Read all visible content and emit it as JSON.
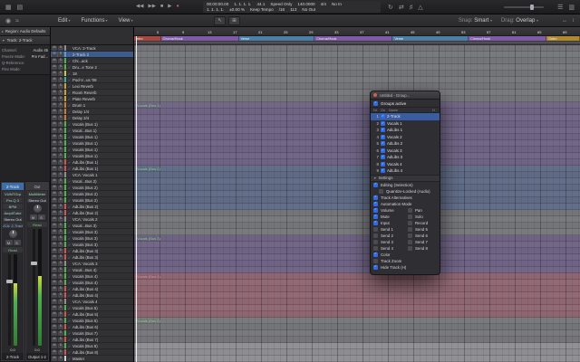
{
  "ui": {
    "check": "✓",
    "chevron": "▾",
    "disclosure_open": "▼",
    "disclosure_closed": "▸"
  },
  "control_bar": {
    "left_icons": [
      {
        "name": "toolbar-toggle-icon",
        "glyph": "▦"
      },
      {
        "name": "library-icon",
        "glyph": "▤"
      }
    ],
    "transport_icons": [
      {
        "name": "rewind-icon",
        "glyph": "◀◀"
      },
      {
        "name": "forward-icon",
        "glyph": "▶▶"
      },
      {
        "name": "stop-icon",
        "glyph": "■"
      },
      {
        "name": "play-icon",
        "glyph": "▶"
      },
      {
        "name": "record-icon",
        "glyph": "●",
        "color": "#d05555"
      }
    ],
    "lcd_row1": [
      "00:00:00.00",
      "1. 1. 1. 1.",
      "44.1",
      "Speed Only",
      "140.0000",
      "4/4",
      "No In"
    ],
    "lcd_row2": [
      "1. 1. 1. 1.",
      "±0.00 %",
      "Keep Tempo",
      "/16",
      "113",
      "No Out"
    ],
    "right_icons": [
      {
        "name": "cycle-icon",
        "glyph": "↻"
      },
      {
        "name": "replace-icon",
        "glyph": "⇄"
      },
      {
        "name": "tuner-icon",
        "glyph": "♯"
      },
      {
        "name": "metronome-icon",
        "glyph": "△"
      }
    ],
    "far_right_icons": [
      {
        "name": "list-editors-icon",
        "glyph": "☰"
      },
      {
        "name": "browsers-icon",
        "glyph": "▥"
      }
    ]
  },
  "toolbar": {
    "left_icons": [
      {
        "name": "automation-icon",
        "glyph": "◉"
      },
      {
        "name": "flex-icon",
        "glyph": "≈"
      }
    ],
    "menus": [
      "Edit",
      "Functions",
      "View"
    ],
    "tool_icons": [
      {
        "name": "pointer-tool-icon",
        "glyph": "↖"
      },
      {
        "name": "marquee-tool-icon",
        "glyph": "⊞"
      }
    ],
    "snap": {
      "label": "Snap:",
      "value": "Smart"
    },
    "drag": {
      "label": "Drag:",
      "value": "Overlap"
    },
    "right_icons": [
      {
        "name": "zoom-horizontal-icon",
        "glyph": "↔"
      },
      {
        "name": "zoom-vertical-icon",
        "glyph": "↕"
      }
    ]
  },
  "inspector": {
    "region_title": "Region: Audio Defaults",
    "track_title": "Track: 2-Track",
    "fields": [
      {
        "label": "Channel:",
        "value": "Audio 45"
      },
      {
        "label": "Freeze Mode:",
        "value": "Pre Fad..."
      },
      {
        "label": "Q-Reference:",
        "value": ""
      },
      {
        "label": "Flex Mode:",
        "value": ""
      }
    ]
  },
  "strips": {
    "left": {
      "header": "2-Track",
      "inserts": [
        "VUMTGrp",
        "Pro-Q 3",
        "BPM",
        "AmpliTube"
      ],
      "output": "Stereo Out",
      "group": "VCA: 2-Track",
      "automation": "Read",
      "mute_label": "M",
      "solo_label": "S",
      "gain": "0.0",
      "name": "2-Track",
      "meter_level": 0.68
    },
    "right": {
      "header": "Out",
      "inserts": [
        "MultiMeter"
      ],
      "output": "Stereo Out",
      "automation": "Read",
      "mute_label": "M",
      "solo_label": "S",
      "gain": "0.0",
      "name": "Output 1-2",
      "meter_level": 0.6
    }
  },
  "track_row_buttons": {
    "mute": "M",
    "solo": "S"
  },
  "tracks": [
    {
      "name": "VCA: 2-Track",
      "color": "#8e8e93",
      "on": false
    },
    {
      "name": "2-Track 2",
      "color": "#5b9bd5",
      "on": true,
      "selected": true
    },
    {
      "name": "Chi...ack",
      "color": "#55b24e",
      "on": true
    },
    {
      "name": "Dru...e Tone 2",
      "color": "#55b24e",
      "on": true
    },
    {
      "name": "18",
      "color": "#c9c94e",
      "on": true
    },
    {
      "name": "Pod-V...us '08",
      "color": "#3fae9e",
      "on": true
    },
    {
      "name": "Lexi Reverb",
      "color": "#c9a23e",
      "on": true
    },
    {
      "name": "Room Reverb",
      "color": "#c9a23e",
      "on": true
    },
    {
      "name": "Plate Reverb",
      "color": "#c9a23e",
      "on": true
    },
    {
      "name": "Drum 1",
      "color": "#d07a3a",
      "on": true
    },
    {
      "name": "Delay 1/4",
      "color": "#d07a3a",
      "on": true
    },
    {
      "name": "Delay 3/4",
      "color": "#d07a3a",
      "on": true
    },
    {
      "name": "Vocals (Bus 1)",
      "color": "#55b24e",
      "on": true
    },
    {
      "name": "Vocal...Bus 1)",
      "color": "#55b24e",
      "on": true
    },
    {
      "name": "Vocals (Bus 1)",
      "color": "#55b24e",
      "on": true
    },
    {
      "name": "Vocals (Bus 1)",
      "color": "#55b24e",
      "on": true
    },
    {
      "name": "Vocals (Bus 1)",
      "color": "#55b24e",
      "on": true
    },
    {
      "name": "Vocals (Bus 1)",
      "color": "#55b24e",
      "on": true
    },
    {
      "name": "AdLibs (Bus 1)",
      "color": "#d05555",
      "on": true
    },
    {
      "name": "AdLibs (Bus 1)",
      "color": "#d05555",
      "on": true
    },
    {
      "name": "VCA: Vocals 1",
      "color": "#8e8e93",
      "on": false
    },
    {
      "name": "Vocal...Bus 2)",
      "color": "#55b24e",
      "on": true
    },
    {
      "name": "Vocals (Bus 2)",
      "color": "#55b24e",
      "on": true
    },
    {
      "name": "Vocals (Bus 2)",
      "color": "#55b24e",
      "on": true
    },
    {
      "name": "Vocals (Bus 2)",
      "color": "#55b24e",
      "on": true
    },
    {
      "name": "AdLibs (Bus 2)",
      "color": "#d05555",
      "on": true
    },
    {
      "name": "AdLibs (Bus 2)",
      "color": "#d05555",
      "on": true
    },
    {
      "name": "VCA: Vocals 2",
      "color": "#8e8e93",
      "on": false
    },
    {
      "name": "Vocal...Bus 3)",
      "color": "#55b24e",
      "on": true
    },
    {
      "name": "Vocals (Bus 3)",
      "color": "#55b24e",
      "on": true
    },
    {
      "name": "Vocals (Bus 3)",
      "color": "#55b24e",
      "on": true
    },
    {
      "name": "Vocals (Bus 3)",
      "color": "#55b24e",
      "on": true
    },
    {
      "name": "AdLibs (Bus 3)",
      "color": "#d05555",
      "on": true
    },
    {
      "name": "AdLibs (Bus 3)",
      "color": "#d05555",
      "on": true
    },
    {
      "name": "VCA: Vocals 3",
      "color": "#8e8e93",
      "on": false
    },
    {
      "name": "Vocal...Bus 4)",
      "color": "#55b24e",
      "on": true
    },
    {
      "name": "Vocals (Bus 4)",
      "color": "#55b24e",
      "on": true
    },
    {
      "name": "Vocals (Bus 4)",
      "color": "#55b24e",
      "on": true
    },
    {
      "name": "AdLibs (Bus 4)",
      "color": "#d05555",
      "on": true
    },
    {
      "name": "AdLibs (Bus 4)",
      "color": "#d05555",
      "on": true
    },
    {
      "name": "VCA: Vocals 4",
      "color": "#8e8e93",
      "on": false
    },
    {
      "name": "Vocals (Bus 5)",
      "color": "#55b24e",
      "on": true
    },
    {
      "name": "AdLibs (Bus 5)",
      "color": "#d05555",
      "on": true
    },
    {
      "name": "Vocals (Bus 6)",
      "color": "#55b24e",
      "on": true
    },
    {
      "name": "AdLibs (Bus 6)",
      "color": "#d05555",
      "on": true
    },
    {
      "name": "Vocals (Bus 7)",
      "color": "#55b24e",
      "on": true
    },
    {
      "name": "AdLibs (Bus 7)",
      "color": "#d05555",
      "on": true
    },
    {
      "name": "Vocals (Bus 8)",
      "color": "#55b24e",
      "on": true
    },
    {
      "name": "AdLibs (Bus 8)",
      "color": "#d05555",
      "on": true
    },
    {
      "name": "Master",
      "color": "#d0d0d4",
      "on": true
    }
  ],
  "arrange": {
    "ruler_labels": [
      "5",
      "9",
      "13",
      "17",
      "21",
      "25",
      "29",
      "33",
      "37",
      "41",
      "45",
      "49",
      "53",
      "57",
      "61",
      "65",
      "69"
    ],
    "markers": [
      {
        "label": "Intro",
        "color": "#a8473f",
        "width": 6
      },
      {
        "label": "Chorus/Hook",
        "color": "#7e5aa8",
        "width": 17.5
      },
      {
        "label": "Verse",
        "color": "#4b7fa8",
        "width": 17
      },
      {
        "label": "Chorus/Hook",
        "color": "#7e5aa8",
        "width": 17.5
      },
      {
        "label": "Verse",
        "color": "#4b7fa8",
        "width": 17
      },
      {
        "label": "Chorus/Hook",
        "color": "#7e5aa8",
        "width": 17.5
      },
      {
        "label": "Outro",
        "color": "#b0892f",
        "width": 7.5
      }
    ],
    "lane_bands": [
      {
        "from": 0,
        "to": 8,
        "type": "gray"
      },
      {
        "from": 9,
        "to": 18,
        "type": "purple"
      },
      {
        "from": 19,
        "to": 25,
        "type": "blue"
      },
      {
        "from": 26,
        "to": 29,
        "type": "gray"
      },
      {
        "from": 30,
        "to": 35,
        "type": "purple"
      },
      {
        "from": 36,
        "to": 42,
        "type": "pink"
      },
      {
        "from": 43,
        "to": 46,
        "type": "gray"
      },
      {
        "from": 47,
        "to": 49,
        "type": "light"
      }
    ],
    "region_labels": [
      {
        "row": 9,
        "text": "Vocals (Bus 1)",
        "color": "#8fe89a"
      },
      {
        "row": 19,
        "text": "Vocals (Bus 2)",
        "color": "#8fe89a"
      },
      {
        "row": 30,
        "text": "Vocals (Bus 3)",
        "color": "#8fe89a"
      },
      {
        "row": 36,
        "text": "Vocals (Bus 4)",
        "color": "#f2a0b4"
      },
      {
        "row": 43,
        "text": "Vocals (Bus 5)",
        "color": "#8fe89a"
      }
    ]
  },
  "groups_window": {
    "title": "Untitled - Group...",
    "groups_active_label": "Groups active",
    "groups_active_checked": true,
    "columns": [
      "Nr.",
      "On",
      "Name",
      "H"
    ],
    "rows": [
      {
        "nr": "1",
        "on": true,
        "name": "2-Track",
        "selected": true
      },
      {
        "nr": "2",
        "on": true,
        "name": "Vocals 1"
      },
      {
        "nr": "3",
        "on": true,
        "name": "AdLibs 1"
      },
      {
        "nr": "4",
        "on": true,
        "name": "Vocals 2"
      },
      {
        "nr": "5",
        "on": true,
        "name": "AdLibs 2"
      },
      {
        "nr": "6",
        "on": true,
        "name": "Vocals 3"
      },
      {
        "nr": "7",
        "on": true,
        "name": "AdLibs 3"
      },
      {
        "nr": "8",
        "on": true,
        "name": "Vocals 4"
      },
      {
        "nr": "9",
        "on": true,
        "name": "AdLibs 4"
      }
    ],
    "settings_label": "Settings",
    "settings": [
      {
        "label": "Editing (Selection)",
        "checked": true
      },
      {
        "label": "Quantize-Locked (Audio)",
        "checked": false,
        "indent": true
      },
      {
        "label": "Track Alternatives",
        "checked": true
      },
      {
        "label": "Automation Mode",
        "checked": true
      }
    ],
    "settings_pairs": [
      {
        "left": {
          "label": "Volume",
          "checked": true
        },
        "right": {
          "label": "Pan",
          "checked": false
        }
      },
      {
        "left": {
          "label": "Mute",
          "checked": true
        },
        "right": {
          "label": "Solo",
          "checked": false
        }
      },
      {
        "left": {
          "label": "Input",
          "checked": true
        },
        "right": {
          "label": "Record",
          "checked": false
        }
      },
      {
        "left": {
          "label": "Send 1",
          "checked": false
        },
        "right": {
          "label": "Send 5",
          "checked": false
        }
      },
      {
        "left": {
          "label": "Send 2",
          "checked": false
        },
        "right": {
          "label": "Send 6",
          "checked": false
        }
      },
      {
        "left": {
          "label": "Send 3",
          "checked": false
        },
        "right": {
          "label": "Send 7",
          "checked": false
        }
      },
      {
        "left": {
          "label": "Send 4",
          "checked": false
        },
        "right": {
          "label": "Send 8",
          "checked": false
        }
      }
    ],
    "settings_bottom": [
      {
        "label": "Color",
        "checked": true
      },
      {
        "label": "Track Zoom",
        "checked": false
      },
      {
        "label": "Hide Track (H)",
        "checked": true
      }
    ]
  }
}
